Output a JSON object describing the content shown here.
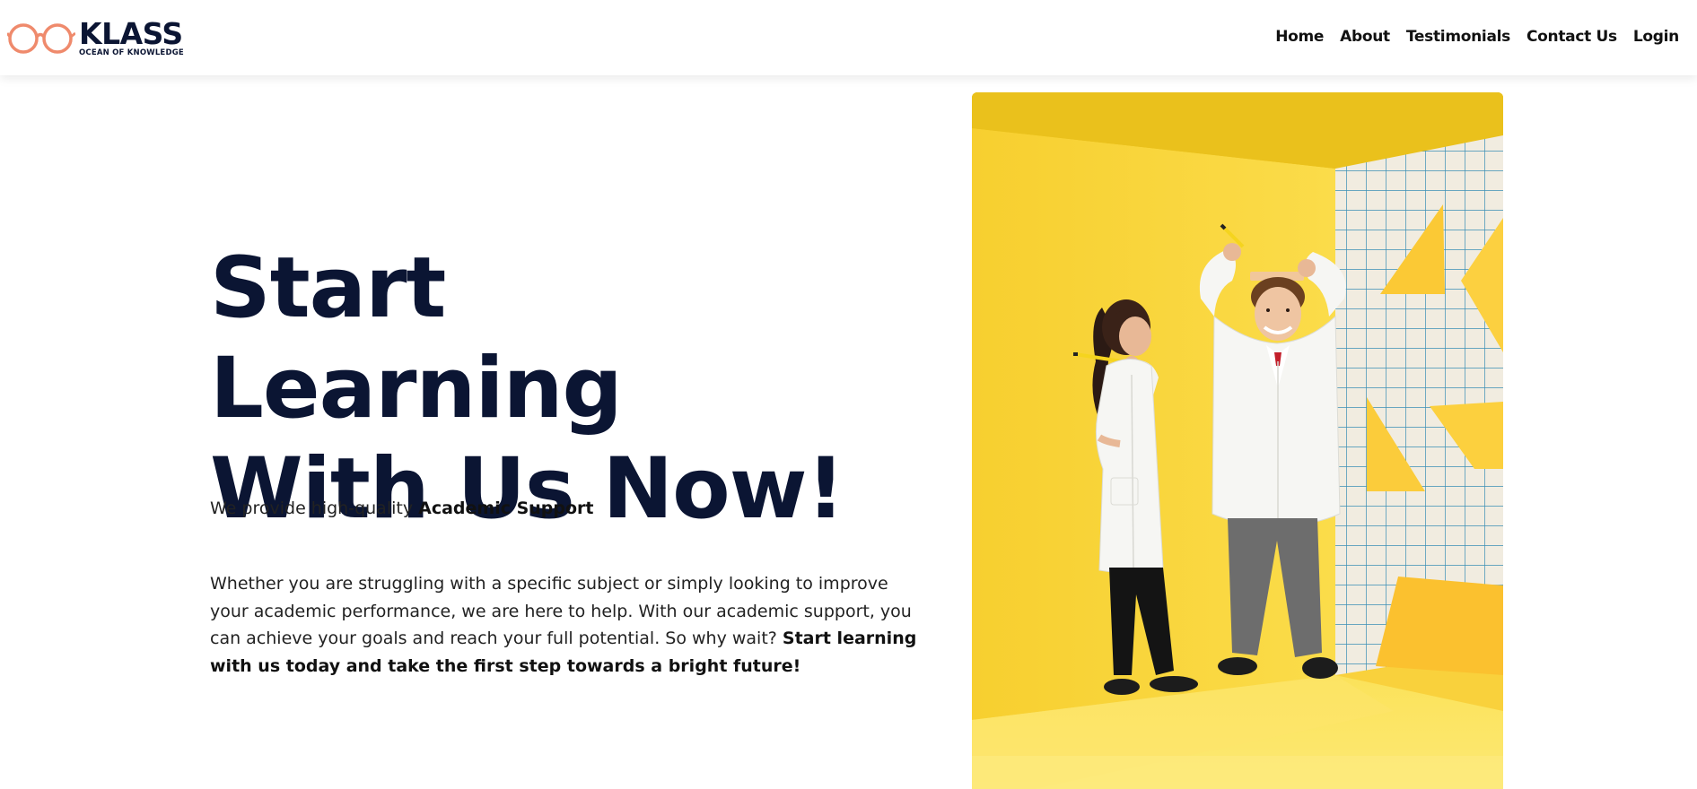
{
  "brand": {
    "name": "KLASS",
    "tagline": "OCEAN OF KNOWLEDGE",
    "logo_icon": "glasses-icon",
    "logo_icon_color": "#ef8a6c",
    "text_color": "#0b1533"
  },
  "nav": {
    "items": [
      {
        "label": "Home"
      },
      {
        "label": "About"
      },
      {
        "label": "Testimonials"
      },
      {
        "label": "Contact Us"
      },
      {
        "label": "Login"
      }
    ]
  },
  "hero": {
    "title_line1": "Start Learning",
    "title_line2": "With Us Now!",
    "intro_prefix": "We provide high-quality ",
    "intro_bold": "Academic Support",
    "body_text": "Whether you are struggling with a specific subject or simply looking to improve your academic performance, we are here to help. With our academic support, you can achieve your goals and reach your full potential. So why wait? ",
    "body_bold": "Start learning with us today and take the first step towards a bright future!"
  },
  "image": {
    "subject": "two children in white lab coats on a yellow studio background"
  },
  "colors": {
    "accent": "#ef8a6c",
    "heading": "#0b1533",
    "image_background": "#f9d13c"
  }
}
